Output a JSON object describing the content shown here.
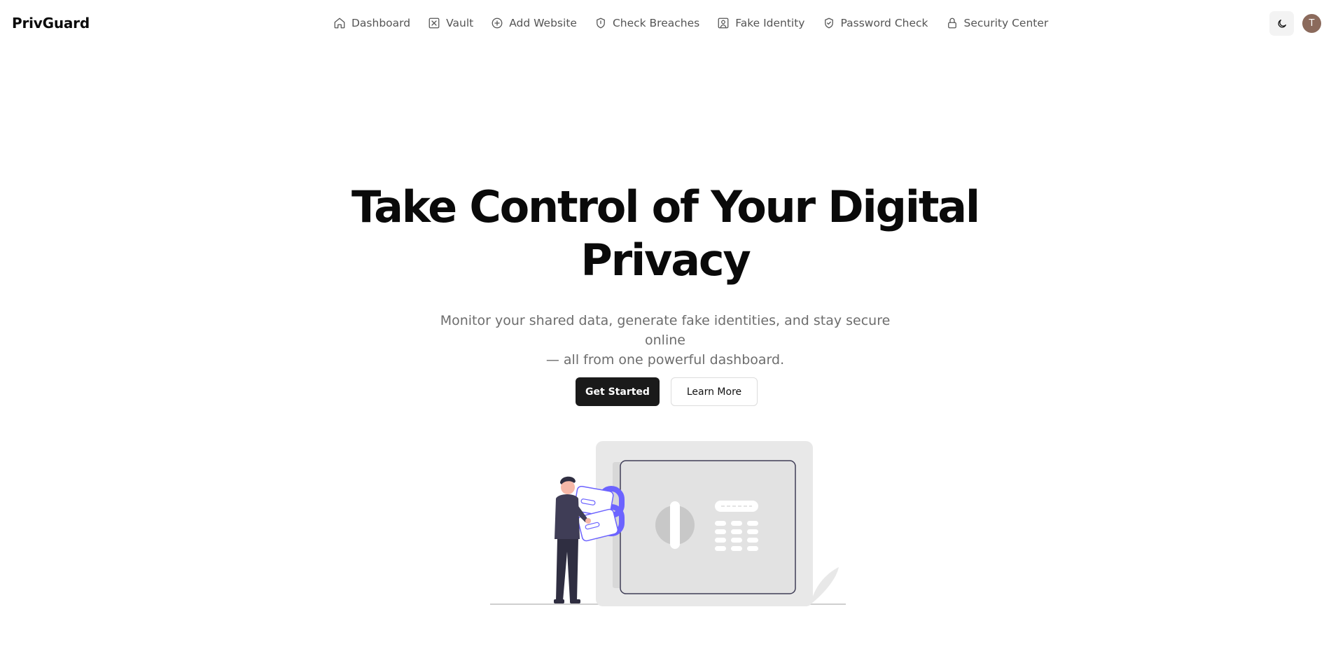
{
  "navbar": {
    "brand": "PrivGuard",
    "items": [
      {
        "label": "Dashboard",
        "icon": "home-icon"
      },
      {
        "label": "Vault",
        "icon": "vault-icon"
      },
      {
        "label": "Add Website",
        "icon": "plus-circle-icon"
      },
      {
        "label": "Check Breaches",
        "icon": "shield-icon"
      },
      {
        "label": "Fake Identity",
        "icon": "user-square-icon"
      },
      {
        "label": "Password Check",
        "icon": "shield-check-icon"
      },
      {
        "label": "Security Center",
        "icon": "lock-icon"
      }
    ],
    "theme_toggle_icon": "moon-icon",
    "avatar_initial": "T"
  },
  "hero": {
    "title_line1": "Take Control of Your Digital",
    "title_line2": "Privacy",
    "subtitle_line1": "Monitor your shared data, generate fake identities, and stay secure online",
    "subtitle_line2": "— all from one powerful dashboard.",
    "primary_button": "Get Started",
    "secondary_button": "Learn More"
  },
  "colors": {
    "primary_button_bg": "#1a1a1a",
    "accent_illustration": "#6c63ff",
    "avatar_bg": "#8b6a5c"
  }
}
